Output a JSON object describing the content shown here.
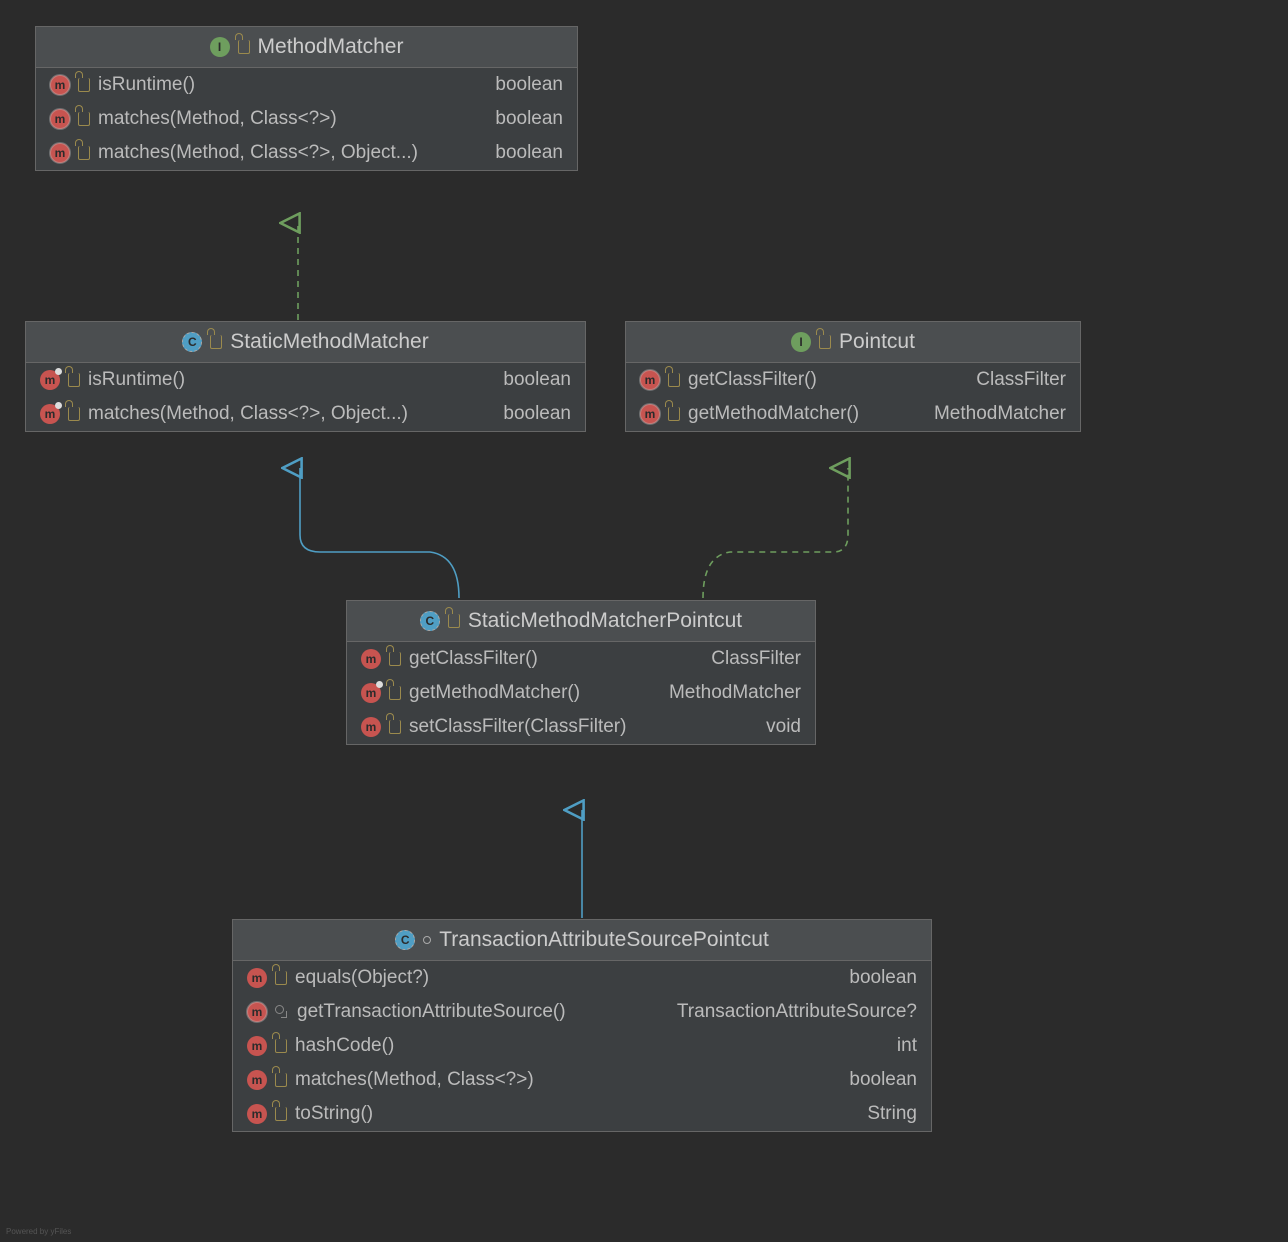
{
  "watermark": "Powered by yFiles",
  "classes": {
    "methodMatcher": {
      "name": "MethodMatcher",
      "kind": "interface",
      "members": [
        {
          "sig": "isRuntime()",
          "ret": "boolean",
          "override": true
        },
        {
          "sig": "matches(Method, Class<?>)",
          "ret": "boolean",
          "override": true
        },
        {
          "sig": "matches(Method, Class<?>, Object...)",
          "ret": "boolean",
          "override": true
        }
      ]
    },
    "staticMethodMatcher": {
      "name": "StaticMethodMatcher",
      "kind": "class-abstract",
      "members": [
        {
          "sig": "isRuntime()",
          "ret": "boolean",
          "abstract": true
        },
        {
          "sig": "matches(Method, Class<?>, Object...)",
          "ret": "boolean",
          "abstract": true
        }
      ]
    },
    "pointcut": {
      "name": "Pointcut",
      "kind": "interface",
      "members": [
        {
          "sig": "getClassFilter()",
          "ret": "ClassFilter",
          "override": true
        },
        {
          "sig": "getMethodMatcher()",
          "ret": "MethodMatcher",
          "override": true
        }
      ]
    },
    "staticMethodMatcherPointcut": {
      "name": "StaticMethodMatcherPointcut",
      "kind": "class-abstract",
      "members": [
        {
          "sig": "getClassFilter()",
          "ret": "ClassFilter"
        },
        {
          "sig": "getMethodMatcher()",
          "ret": "MethodMatcher",
          "abstract": true
        },
        {
          "sig": "setClassFilter(ClassFilter)",
          "ret": "void"
        }
      ]
    },
    "transactionAttributeSourcePointcut": {
      "name": "TransactionAttributeSourcePointcut",
      "kind": "class-abstract",
      "members": [
        {
          "sig": "equals(Object?)",
          "ret": "boolean"
        },
        {
          "sig": "getTransactionAttributeSource()",
          "ret": "TransactionAttributeSource?",
          "override": true,
          "vis": "protected"
        },
        {
          "sig": "hashCode()",
          "ret": "int"
        },
        {
          "sig": "matches(Method, Class<?>)",
          "ret": "boolean"
        },
        {
          "sig": "toString()",
          "ret": "String"
        }
      ]
    }
  },
  "relations": [
    {
      "from": "staticMethodMatcher",
      "to": "methodMatcher",
      "type": "implements"
    },
    {
      "from": "staticMethodMatcherPointcut",
      "to": "staticMethodMatcher",
      "type": "extends"
    },
    {
      "from": "staticMethodMatcherPointcut",
      "to": "pointcut",
      "type": "implements"
    },
    {
      "from": "transactionAttributeSourcePointcut",
      "to": "staticMethodMatcherPointcut",
      "type": "extends"
    }
  ]
}
